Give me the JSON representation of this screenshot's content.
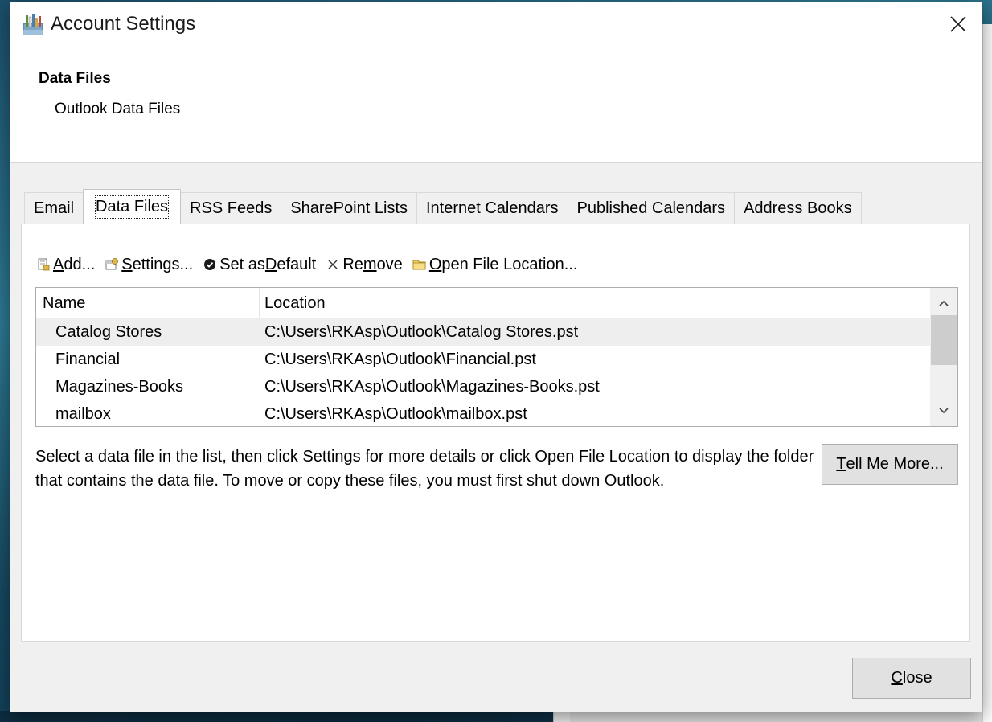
{
  "window": {
    "title": "Account Settings",
    "close_glyph": "✕"
  },
  "header": {
    "section_title": "Data Files",
    "section_subtitle": "Outlook Data Files"
  },
  "tabs": [
    {
      "label": "Email",
      "active": false
    },
    {
      "label": "Data Files",
      "active": true
    },
    {
      "label": "RSS Feeds",
      "active": false
    },
    {
      "label": "SharePoint Lists",
      "active": false
    },
    {
      "label": "Internet Calendars",
      "active": false
    },
    {
      "label": "Published Calendars",
      "active": false
    },
    {
      "label": "Address Books",
      "active": false
    }
  ],
  "toolbar": {
    "add": {
      "pre": "",
      "key": "A",
      "post": "dd...",
      "icon": "add-datafile-icon"
    },
    "settings": {
      "pre": "",
      "key": "S",
      "post": "ettings...",
      "icon": "settings-datafile-icon"
    },
    "set_default": {
      "pre": "Set as ",
      "key": "D",
      "post": "efault",
      "icon": "checkmark-circle-icon"
    },
    "remove": {
      "pre": "Re",
      "key": "m",
      "post": "ove",
      "icon": "x-icon"
    },
    "open_location": {
      "pre": "",
      "key": "O",
      "post": "pen File Location...",
      "icon": "folder-icon"
    }
  },
  "list": {
    "columns": {
      "name": "Name",
      "location": "Location"
    },
    "rows": [
      {
        "name": "Catalog Stores",
        "location": "C:\\Users\\RKAsp\\Outlook\\Catalog Stores.pst",
        "selected": true
      },
      {
        "name": "Financial",
        "location": "C:\\Users\\RKAsp\\Outlook\\Financial.pst",
        "selected": false
      },
      {
        "name": "Magazines-Books",
        "location": "C:\\Users\\RKAsp\\Outlook\\Magazines-Books.pst",
        "selected": false
      },
      {
        "name": "mailbox",
        "location": "C:\\Users\\RKAsp\\Outlook\\mailbox.pst",
        "selected": false
      }
    ]
  },
  "info_text": "Select a data file in the list, then click Settings for more details or click Open File Location to display the folder that contains the data file. To move or copy these files, you must first shut down Outlook.",
  "buttons": {
    "tell_me_more": {
      "key": "T",
      "post": "ell Me More..."
    },
    "close": {
      "key": "C",
      "post": "lose"
    }
  },
  "colors": {
    "dialog_bg": "#f0f0f0",
    "panel_bg": "#ffffff",
    "selected_row": "#eeeeee",
    "button_bg": "#e1e1e1"
  }
}
